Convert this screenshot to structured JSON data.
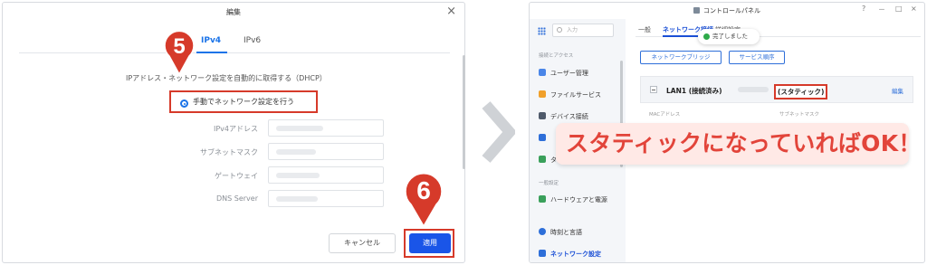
{
  "dialog": {
    "title": "編集",
    "close_glyph": "×",
    "tabs": [
      {
        "label": "IPv4",
        "active": true
      },
      {
        "label": "IPv6",
        "active": false
      }
    ],
    "dhcp_label": "IPアドレス・ネットワーク設定を自動的に取得する（DHCP）",
    "manual_label": "手動でネットワーク設定を行う",
    "fields": [
      {
        "label": "IPv4アドレス"
      },
      {
        "label": "サブネットマスク"
      },
      {
        "label": "ゲートウェイ"
      },
      {
        "label": "DNS Server"
      }
    ],
    "cancel_label": "キャンセル",
    "apply_label": "適用",
    "step_badges": [
      "5",
      "6"
    ]
  },
  "window": {
    "title": "コントロールパネル",
    "controls": [
      "?",
      "－",
      "□",
      "×"
    ],
    "search_placeholder": "入力",
    "sidebar": {
      "section1": "接続とアクセス",
      "items1": [
        "ユーザー管理",
        "ファイルサービス",
        "デバイス接続",
        "",
        "ターミナル"
      ],
      "section2": "一般設定",
      "items2": [
        "ハードウェアと電源",
        "時刻と言語",
        "ネットワーク設定"
      ]
    },
    "tabs": [
      "一般",
      "ネットワーク接続",
      "詳細設定"
    ],
    "toast": "完了しました",
    "buttons": [
      "ネットワークブリッジ",
      "サービス順序"
    ],
    "lan": {
      "name": "LAN1 (接続済み)",
      "status": "(スタティック)",
      "edit": "編集",
      "col_mac": "MACアドレス",
      "col_subnet": "サブネットマスク"
    }
  },
  "banner_text": "スタティックになっていればOK！",
  "colors": {
    "accent": "#1a55e8",
    "highlight_red": "#d63a2a",
    "banner_bg": "#ffe9e6",
    "banner_text": "#e2443a"
  }
}
